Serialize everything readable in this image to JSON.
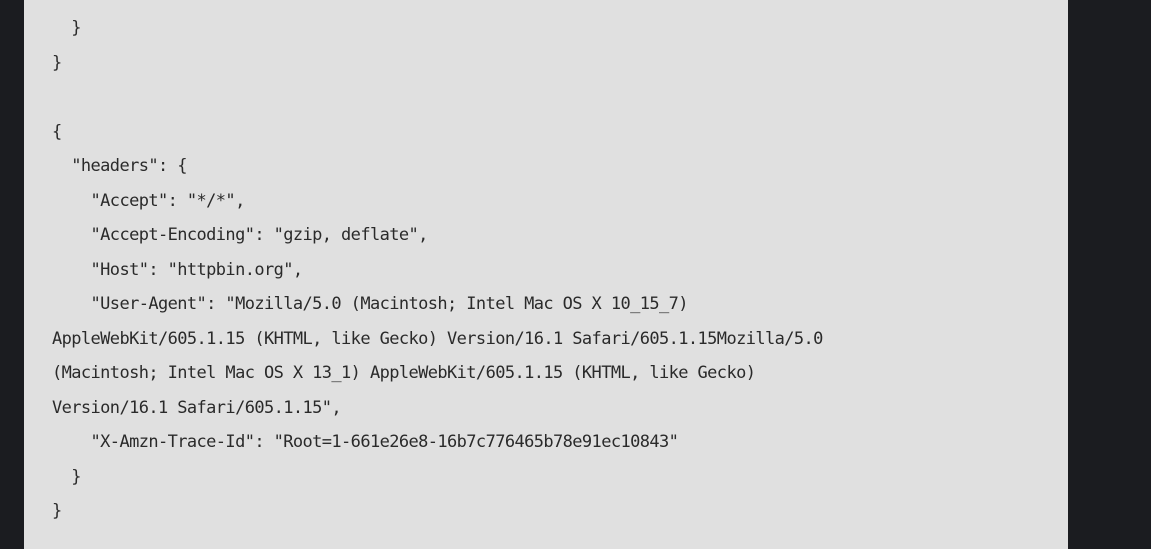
{
  "code_block": {
    "lines": [
      "  }",
      "}",
      "",
      "{",
      "  \"headers\": {",
      "    \"Accept\": \"*/*\",",
      "    \"Accept-Encoding\": \"gzip, deflate\",",
      "    \"Host\": \"httpbin.org\",",
      "    \"User-Agent\": \"Mozilla/5.0 (Macintosh; Intel Mac OS X 10_15_7)",
      "AppleWebKit/605.1.15 (KHTML, like Gecko) Version/16.1 Safari/605.1.15Mozilla/5.0",
      "(Macintosh; Intel Mac OS X 13_1) AppleWebKit/605.1.15 (KHTML, like Gecko)",
      "Version/16.1 Safari/605.1.15\",",
      "    \"X-Amzn-Trace-Id\": \"Root=1-661e26e8-16b7c776465b78e91ec10843\"",
      "  }",
      "}"
    ]
  },
  "colors": {
    "panel_background": "#e0e0e0",
    "page_background": "#1b1c20",
    "text": "#2a2a2a"
  }
}
